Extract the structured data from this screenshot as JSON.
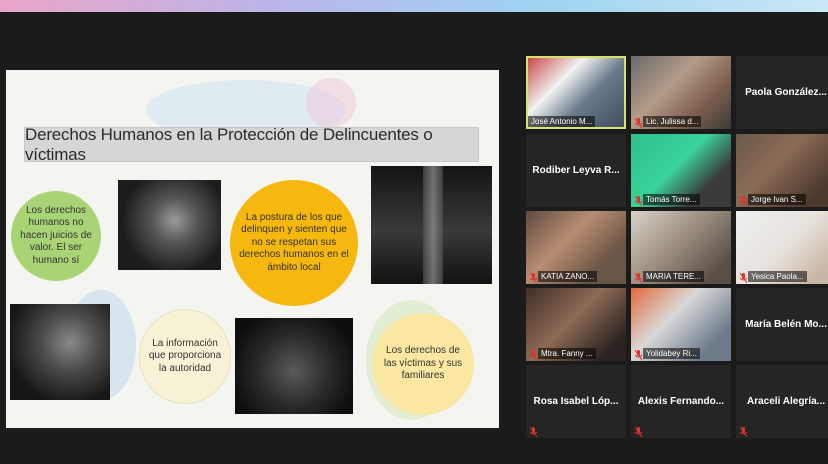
{
  "slide": {
    "title": "Derechos Humanos en la Protección de Delincuentes o víctimas",
    "bubble_left_top": "Los derechos humanos no hacen juicios de valor. El ser humano sí",
    "bubble_center_orange": "La postura de los que delinquen y sienten que no se respetan sus derechos humanos en el ámbito local",
    "bubble_left_bottom": "La información que proporciona la autoridad",
    "bubble_right_bottom": "Los derechos de las víctimas y sus familiares"
  },
  "participants": [
    {
      "name": "José Antonio M...",
      "video": true,
      "active": true
    },
    {
      "name": "Lic. Julissa d...",
      "video": true
    },
    {
      "name": "Paola González...",
      "video": false
    },
    {
      "name": "Rodiber Leyva R...",
      "video": false
    },
    {
      "name": "Tomás Torre...",
      "video": true
    },
    {
      "name": "Jorge Ivan S...",
      "video": true
    },
    {
      "name": "KATIA ZANO...",
      "video": true
    },
    {
      "name": "MARIA TERE...",
      "video": true
    },
    {
      "name": "Yesica Paola...",
      "video": true
    },
    {
      "name": "Mtra. Fanny ...",
      "video": true
    },
    {
      "name": "Yolidabey Ri...",
      "video": true
    },
    {
      "name": "María Belén Mo...",
      "video": false
    },
    {
      "name": "Rosa Isabel Lóp...",
      "video": false
    },
    {
      "name": "Alexis Fernando...",
      "video": false
    },
    {
      "name": "Araceli Alegría...",
      "video": false
    }
  ],
  "colors": {
    "muted_icon": "#e0332d",
    "active_border": "#d6e26a"
  }
}
